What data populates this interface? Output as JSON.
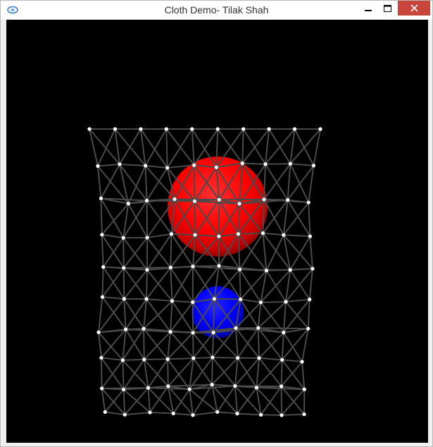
{
  "window": {
    "title": "Cloth Demo- Tilak Shah",
    "app_icon": "opengl-app-icon",
    "controls": {
      "minimize_icon": "minimize-icon",
      "maximize_icon": "maximize-icon",
      "close_icon": "close-icon",
      "close_color": "#c7453b"
    }
  },
  "scene": {
    "background_color": "#000000",
    "cloth": {
      "rows": 11,
      "columns": 10,
      "point_color": "#ffffff",
      "spring_color": "#4a4a4a"
    },
    "spheres": [
      {
        "name": "red-sphere",
        "color": "#ff0000"
      },
      {
        "name": "blue-sphere",
        "color": "#0000ff"
      }
    ]
  }
}
